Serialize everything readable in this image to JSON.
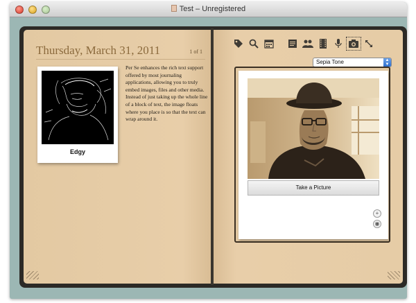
{
  "window": {
    "title": "Test – Unregistered"
  },
  "journal": {
    "date": "Thursday, March 31, 2011",
    "page_count": "1 of 1",
    "polaroid_caption": "Edgy",
    "body_text": "Per Se enhances the rich text support offered by most journaling applications, allowing you to truly embed images, files and other media. Instead of just taking up the whole line of a block of text, the image floats where you place is so that the text can wrap around it."
  },
  "toolbar": {
    "icons": [
      "tag-icon",
      "search-icon",
      "calendar-icon",
      "notes-icon",
      "people-icon",
      "film-icon",
      "microphone-icon",
      "camera-icon",
      "expand-icon"
    ],
    "glyphs": [
      "🏷",
      "⌕",
      "▦",
      "▤",
      "☘",
      "▮",
      "↓",
      "▣",
      "↗"
    ]
  },
  "camera": {
    "filter_selected": "Sepia Tone",
    "take_picture_label": "Take a Picture",
    "zoom_in_glyph": "+",
    "preview_glyph": "◉"
  },
  "colors": {
    "window_bg": "#9cb7b4",
    "page": "#e6cca6",
    "heading": "#8b6a3d",
    "book_cover": "#2c2a26"
  }
}
